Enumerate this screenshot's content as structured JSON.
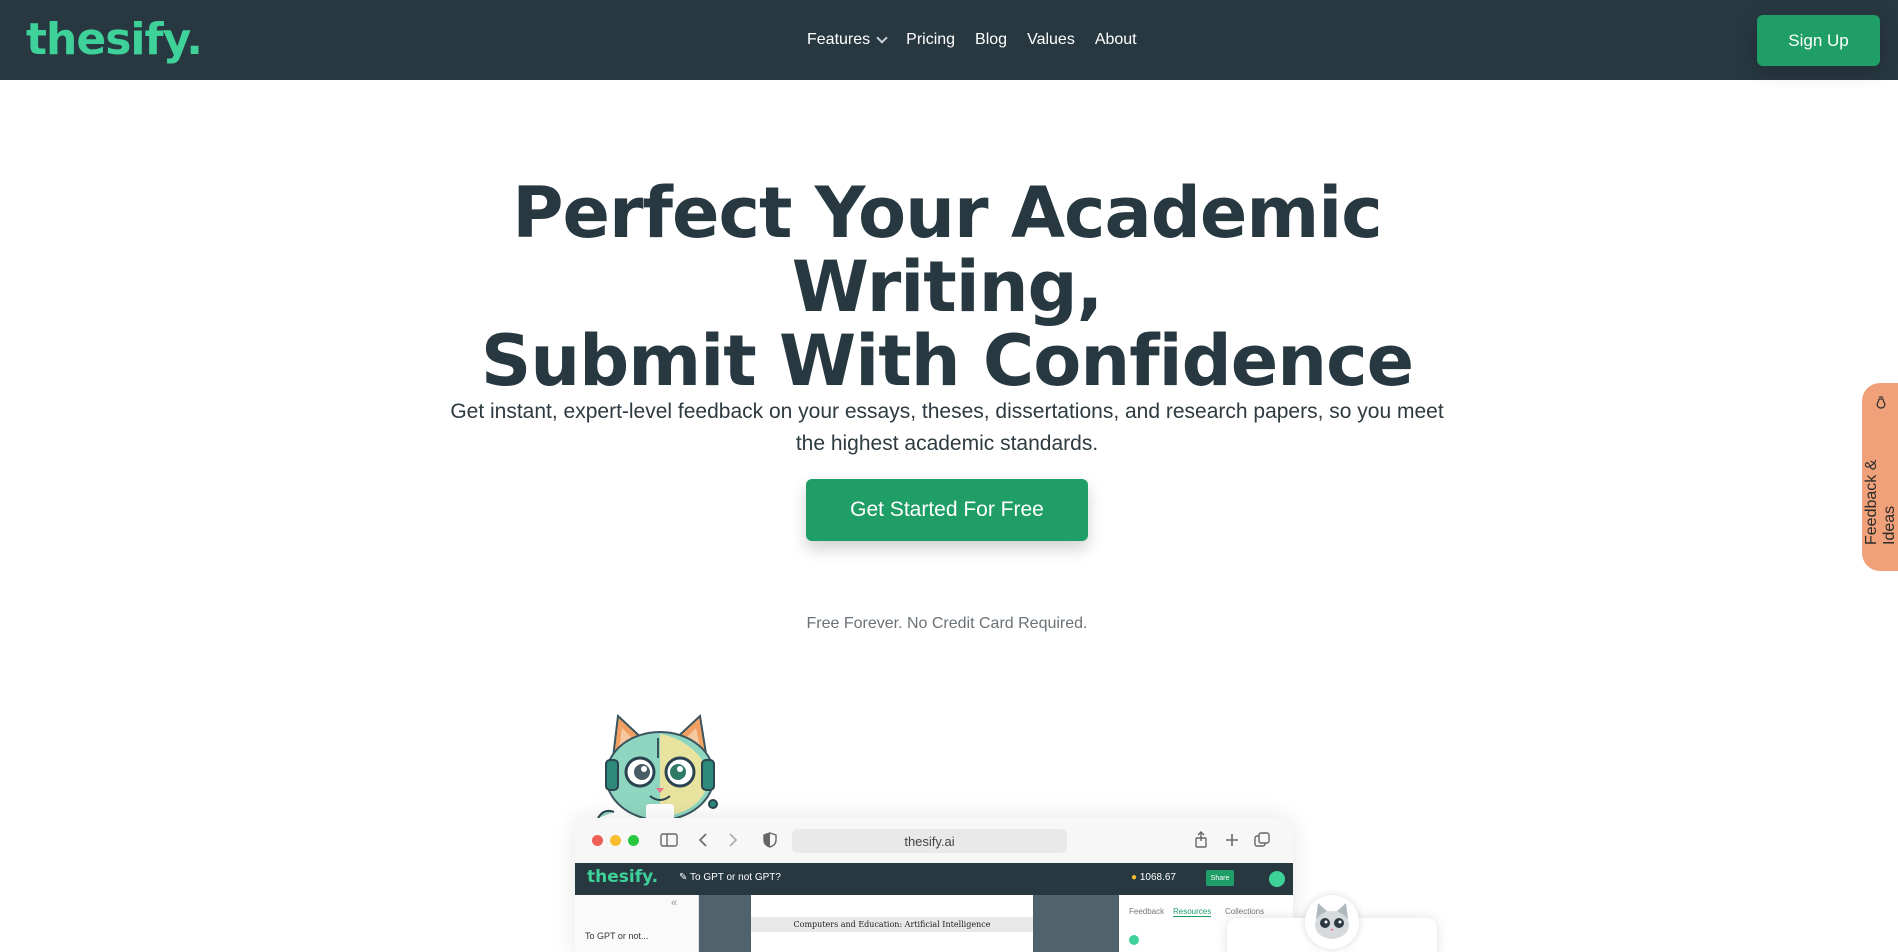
{
  "nav": {
    "logo": "thesify.",
    "links": [
      "Features",
      "Pricing",
      "Blog",
      "Values",
      "About"
    ],
    "signup": "Sign Up"
  },
  "hero": {
    "title_line1": "Perfect Your Academic Writing,",
    "title_line2": "Submit With Confidence",
    "subtitle": "Get instant, expert-level feedback on your essays, theses, dissertations, and research papers, so you meet the highest academic standards.",
    "cta": "Get Started For Free",
    "fine_print": "Free Forever. No Credit Card Required."
  },
  "feedback_tab": {
    "label": "Feedback & Ideas"
  },
  "mockup": {
    "url": "thesify.ai",
    "app_logo": "thesify.",
    "doc_name": "To GPT or not GPT?",
    "credits": "1068.67",
    "share": "Share",
    "sidebar_item": "To GPT or not...",
    "doc_title": "Computers and Education: Artificial Intelligence",
    "tabs": [
      "Feedback",
      "Resources",
      "Collections"
    ]
  },
  "colors": {
    "nav_bg": "#283840",
    "brand_green": "#3ed29a",
    "button_green": "#1f9e67",
    "feedback_tab": "#f0a179"
  }
}
